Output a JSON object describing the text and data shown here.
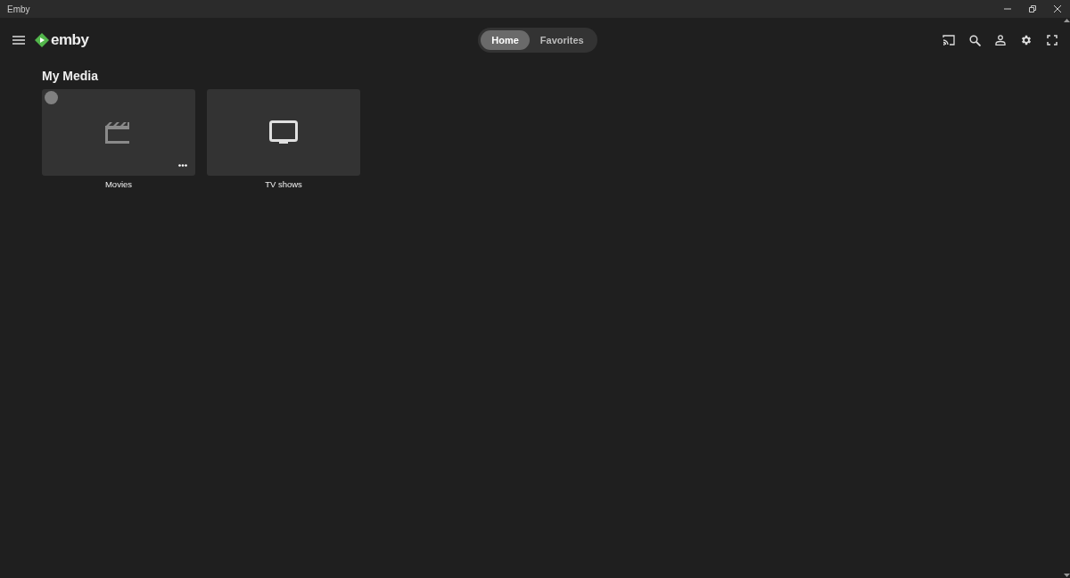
{
  "window": {
    "title": "Emby"
  },
  "header": {
    "logo_text": "emby"
  },
  "tabs": [
    {
      "label": "Home",
      "selected": true
    },
    {
      "label": "Favorites",
      "selected": false
    }
  ],
  "section": {
    "title": "My Media"
  },
  "libraries": [
    {
      "name": "Movies",
      "kind": "movies",
      "hovered": true
    },
    {
      "name": "TV shows",
      "kind": "tv",
      "hovered": false
    }
  ]
}
